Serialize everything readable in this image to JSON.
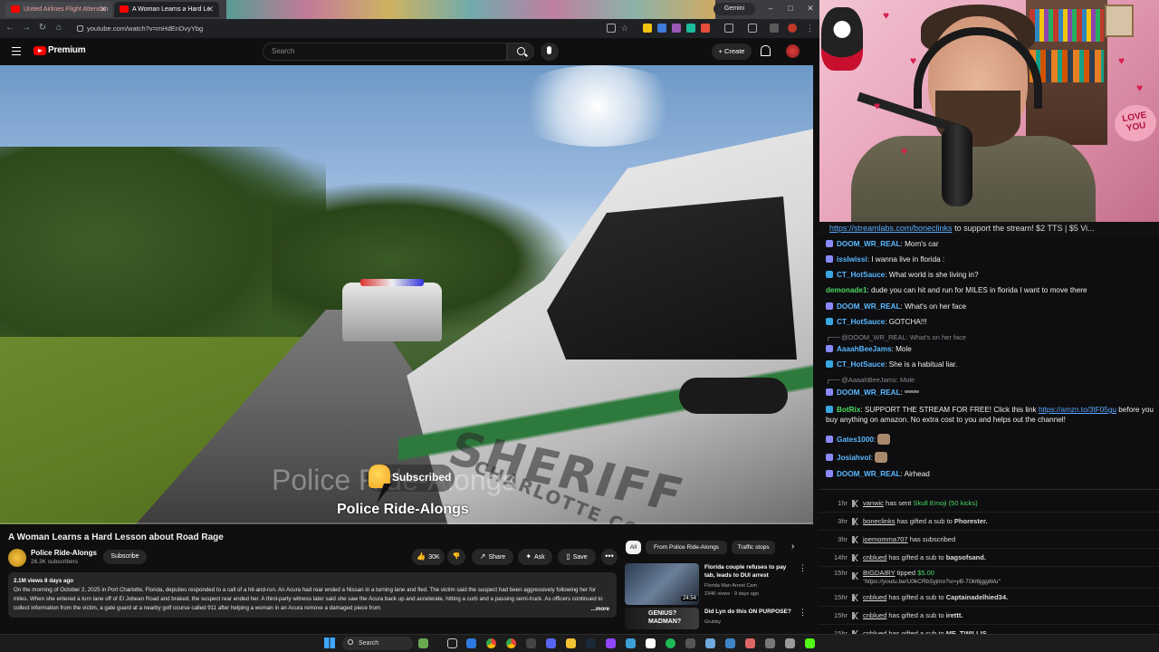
{
  "browser": {
    "tabs": [
      {
        "title": "United Airlines Flight Attendan",
        "active": false
      },
      {
        "title": "A Woman Learns a Hard Le",
        "active": true
      }
    ],
    "gemini_label": "Gemini",
    "url": "youtube.com/watch?v=mHdEnDvyYbg"
  },
  "youtube": {
    "logo_text": "Premium",
    "search_placeholder": "Search",
    "create_label": "+ Create",
    "video": {
      "watermark_channel": "Police Ride-Alongs",
      "subscribed_label": "Subscribed",
      "channel_caption": "Police Ride-Alongs",
      "sheriff_text": "SHERIFF",
      "county_text": "CHARLOTTE COUNTY",
      "progress_fraction": 0.0
    },
    "title": "A Woman Learns a Hard Lesson about Road Rage",
    "channel": {
      "name": "Police Ride-Alongs",
      "subscribers": "26.3K subscribers",
      "subscribe_label": "Subscribe"
    },
    "actions": {
      "likes": "30K",
      "share": "Share",
      "ask": "Ask",
      "save": "Save",
      "more": "•••"
    },
    "description": {
      "meta": "2.1M views  8 days ago",
      "text": "On the morning of October 2, 2025 in Port Charlotte, Florida, deputies responded to a call of a hit-and-run. An Acura had rear ended a Nissan in a turning lane and fled. The victim said the suspect had been aggressively following her for miles. When she entered a turn lane off of El Jobean Road and braked, the suspect rear ended her. A third-party witness later said she saw the Acura back up and accelerate, hitting a curb and a passing semi-truck. As officers continued to collect information from the victim, a gate guard at a nearby golf course called 911 after helping a woman in an Acura remove a damaged piece from",
      "more_label": "...more"
    },
    "chips": [
      "All",
      "From Police Ride-Alongs",
      "Traffic stops"
    ],
    "recommendations": [
      {
        "title": "Florida couple refuses to pay tab, leads to DUI arrest",
        "channel": "Florida Man Arrest Cam",
        "meta": "234K views · 9 days ago",
        "duration": "24:54"
      },
      {
        "title": "Did Lyn do this ON PURPOSE?",
        "channel": "Grubby",
        "meta": "",
        "thumb_text": "GENIUS? MADMAN?"
      }
    ]
  },
  "stream": {
    "love_sign": "LOVE YOU",
    "banner": {
      "link": "https://streamlabs.com/boneclinks",
      "text": " to support the stream! $2 TTS | $5 Vi..."
    },
    "chat": [
      {
        "user": "DOOM_WR_REAL",
        "color": "#5ab8ff",
        "text": " Mom's car",
        "badge": "#8a8aff"
      },
      {
        "user": "isslwissi",
        "color": "#5ab8ff",
        "text": " I wanna live in florida :",
        "badge": "#8a8aff"
      },
      {
        "user": "CT_HotSauce",
        "color": "#5ab8ff",
        "text": " What world is she living in?",
        "badge": "#39a7e0"
      },
      {
        "user": "demonade1",
        "color": "#4cd964",
        "text": " dude you can hit and run for MILES in florida I want to move there",
        "badge": ""
      },
      {
        "user": "DOOM_WR_REAL",
        "color": "#5ab8ff",
        "text": " What's on her face",
        "badge": "#8a8aff"
      },
      {
        "user": "CT_HotSauce",
        "color": "#5ab8ff",
        "text": " GOTCHA!!!",
        "badge": "#39a7e0"
      },
      {
        "reply": "@DOOM_WR_REAL: What's on her face"
      },
      {
        "user": "AaaahBeeJams",
        "color": "#5ab8ff",
        "text": " Mole",
        "badge": "#8a8aff"
      },
      {
        "user": "CT_HotSauce",
        "color": "#5ab8ff",
        "text": " She is a habitual liar.",
        "badge": "#39a7e0"
      },
      {
        "reply": "@AaaahBeeJams: Mole"
      },
      {
        "user": "DOOM_WR_REAL",
        "color": "#5ab8ff",
        "text": " ʷʷʷʷ",
        "badge": "#8a8aff"
      },
      {
        "user": "BotRix",
        "color": "#4cd964",
        "text": " SUPPORT THE STREAM FOR FREE! Click this link ",
        "link": "https://amzn.to/3tF05gu",
        "text2": " before you buy anything on amazon. No extra cost to you and helps out the channel!",
        "badge": "#39a7e0"
      },
      {
        "user": "Gates1000",
        "color": "#5ab8ff",
        "text": "",
        "badge": "#8a8aff"
      },
      {
        "user": "Josiahvol",
        "color": "#5ab8ff",
        "text": "",
        "badge": "#8a8aff"
      },
      {
        "user": "DOOM_WR_REAL",
        "color": "#5ab8ff",
        "text": " Airhead",
        "badge": "#8a8aff"
      }
    ],
    "events": [
      {
        "time": "1hr",
        "user": "vanwic",
        "text": " has sent ",
        "highlight": "Skull Emoji (50 kicks)"
      },
      {
        "time": "3hr",
        "user": "boneclinks",
        "text": " has gifted a sub to ",
        "target": "Phorester."
      },
      {
        "time": "3hr",
        "user": "joemomma707",
        "text": " has subscribed",
        "target": ""
      },
      {
        "time": "14hr",
        "user": "cnblued",
        "text": " has gifted a sub to ",
        "target": "bagsofsand."
      },
      {
        "time": "15hr",
        "user": "BIGDAIRY",
        "text": " tipped ",
        "highlight": "$5.00",
        "sub": "\"https://youtu.be/U0kCRbSyjmo?si=yB-T0kl6jgjg6iIu\""
      },
      {
        "time": "15hr",
        "user": "cnblued",
        "text": " has gifted a sub to ",
        "target": "Captainadelhied34."
      },
      {
        "time": "15hr",
        "user": "cnblued",
        "text": " has gifted a sub to ",
        "target": "irettt."
      },
      {
        "time": "15hr",
        "user": "cnblued",
        "text": " has gifted a sub to ",
        "target": "MF_TWILLIS."
      }
    ]
  },
  "taskbar": {
    "search_label": "Search"
  }
}
